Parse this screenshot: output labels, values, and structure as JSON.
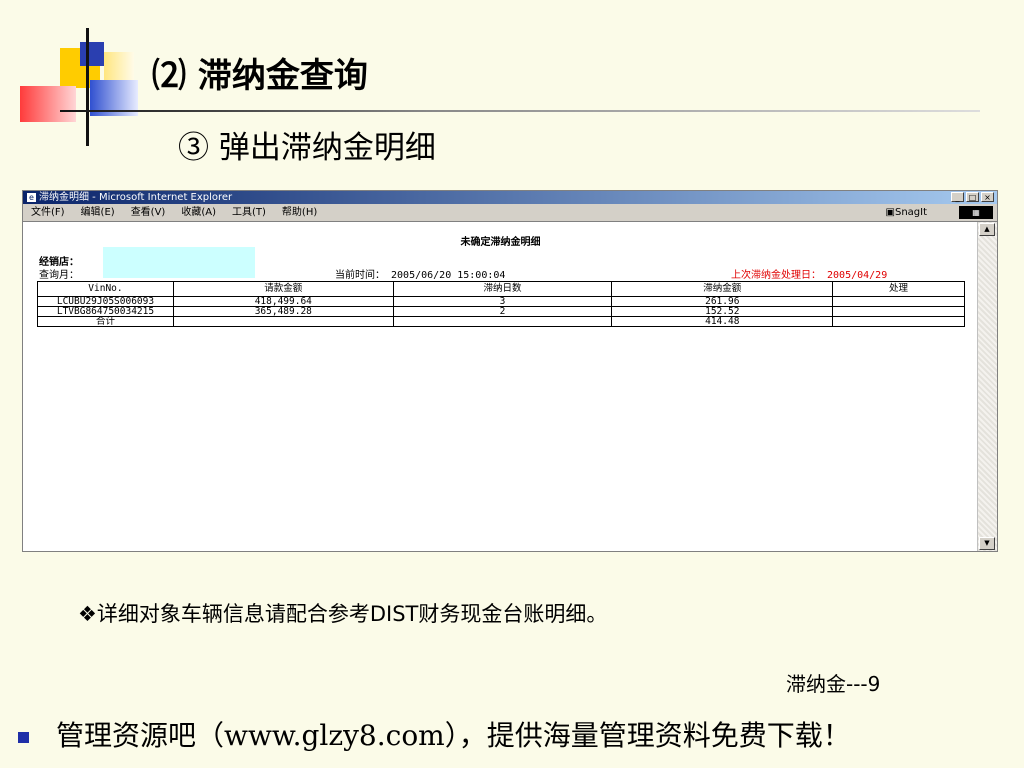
{
  "slide": {
    "title": "⑵ 滞纳金查询",
    "subtitle": "③  弹出滞纳金明细",
    "note": "❖详细对象车辆信息请配合参考DIST财务现金台账明细。",
    "page_number": "滞纳金---9",
    "footer": "管理资源吧（www.glzy8.com），提供海量管理资料免费下载！"
  },
  "window": {
    "title": "滞纳金明细 - Microsoft Internet Explorer",
    "menu": [
      "文件(F)",
      "编辑(E)",
      "查看(V)",
      "收藏(A)",
      "工具(T)",
      "帮助(H)"
    ],
    "snagit": "SnagIt"
  },
  "report": {
    "title": "未确定滞纳金明细",
    "dealer_label": "经销店：",
    "query_label": "查询月：",
    "print_time": "当前时间： 2005/06/20 15:00:04",
    "last_process": "上次滞纳金处理日： 2005/04/29",
    "headers": [
      "VinNo.",
      "请款金额",
      "滞纳日数",
      "滞纳金额",
      "处理"
    ],
    "rows": [
      [
        "LCUBU29J05S006093",
        "418,499.64",
        "3",
        "261.96",
        ""
      ],
      [
        "LTVBG864750034215",
        "365,489.28",
        "2",
        "152.52",
        ""
      ]
    ],
    "total": [
      "合计",
      "",
      "",
      "414.48",
      ""
    ]
  },
  "colors": {
    "titlebar": "#0a246a",
    "dealer_box": "#ccffff",
    "last_date": "#e00000",
    "bullet": "#1f2fa8"
  }
}
